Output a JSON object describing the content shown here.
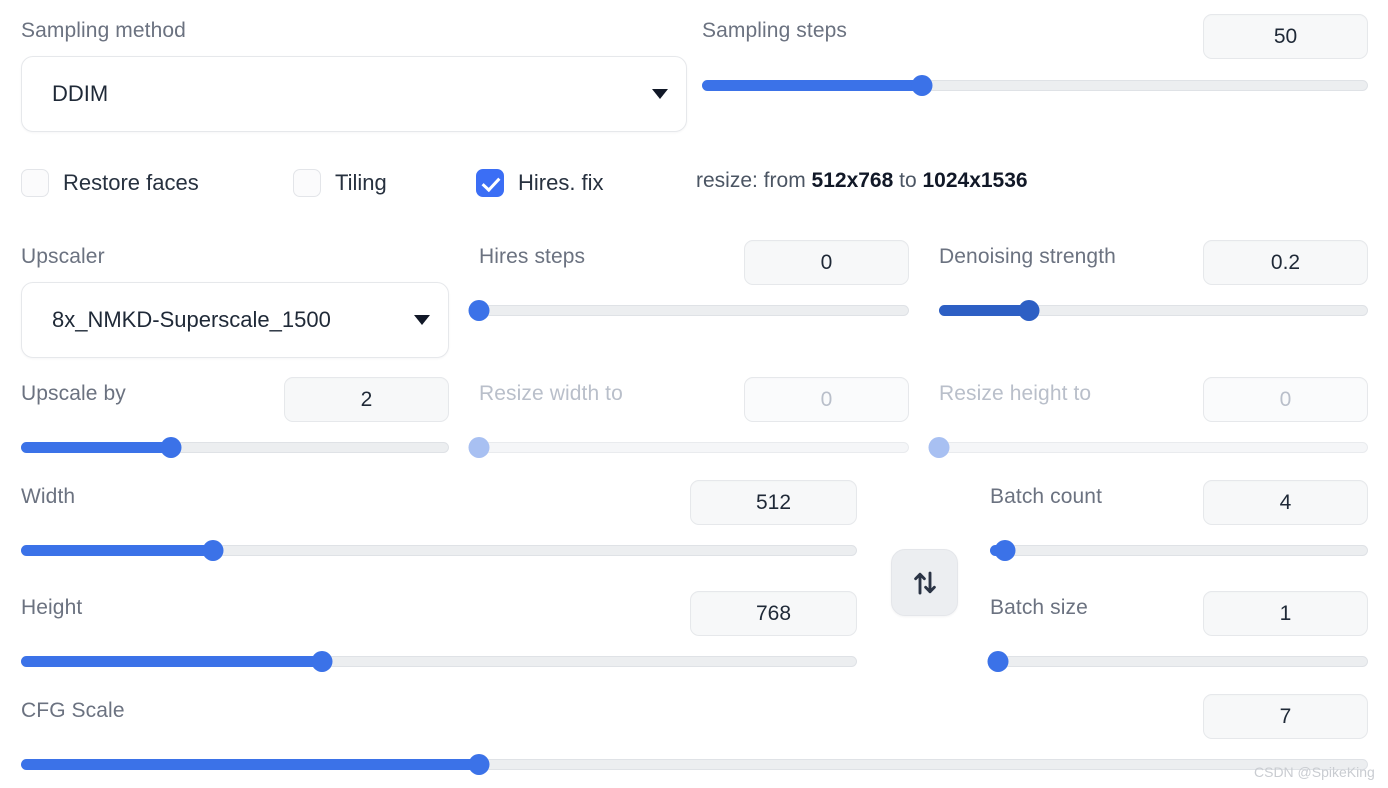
{
  "sampling": {
    "method_label": "Sampling method",
    "method_value": "DDIM",
    "steps_label": "Sampling steps",
    "steps_value": "50",
    "steps_percent": 33
  },
  "toggles": [
    {
      "label": "Restore faces",
      "checked": false,
      "name": "restore-faces"
    },
    {
      "label": "Tiling",
      "checked": false,
      "name": "tiling"
    },
    {
      "label": "Hires. fix",
      "checked": true,
      "name": "hires-fix"
    }
  ],
  "resize_note": {
    "prefix": "resize: from ",
    "from": "512x768",
    "middle": " to ",
    "to": "1024x1536"
  },
  "upscaler": {
    "label": "Upscaler",
    "value": "8x_NMKD-Superscale_1500"
  },
  "hires_steps": {
    "label": "Hires steps",
    "value": "0",
    "percent": 0
  },
  "denoising": {
    "label": "Denoising strength",
    "value": "0.2",
    "percent": 21
  },
  "upscale_by": {
    "label": "Upscale by",
    "value": "2",
    "percent": 35
  },
  "resize_width": {
    "label": "Resize width to",
    "value": "0",
    "percent": 0,
    "disabled": true
  },
  "resize_height": {
    "label": "Resize height to",
    "value": "0",
    "percent": 0,
    "disabled": true
  },
  "width": {
    "label": "Width",
    "value": "512",
    "percent": 23
  },
  "height": {
    "label": "Height",
    "value": "768",
    "percent": 36
  },
  "cfg_scale": {
    "label": "CFG Scale",
    "value": "7",
    "percent": 34
  },
  "batch_count": {
    "label": "Batch count",
    "value": "4",
    "percent": 4
  },
  "batch_size": {
    "label": "Batch size",
    "value": "1",
    "percent": 2
  },
  "swap_button": {
    "icon": "swap-vertical-arrows-icon",
    "glyph": "⇅"
  },
  "watermark": "CSDN @SpikeKing",
  "colors": {
    "accent": "#3b6ef5",
    "slider_fill": "#3b72e8",
    "slider_fill_dark": "#2d5fc4",
    "track": "#eceef0",
    "label": "#6b7280",
    "disabled": "#b9bfca"
  }
}
